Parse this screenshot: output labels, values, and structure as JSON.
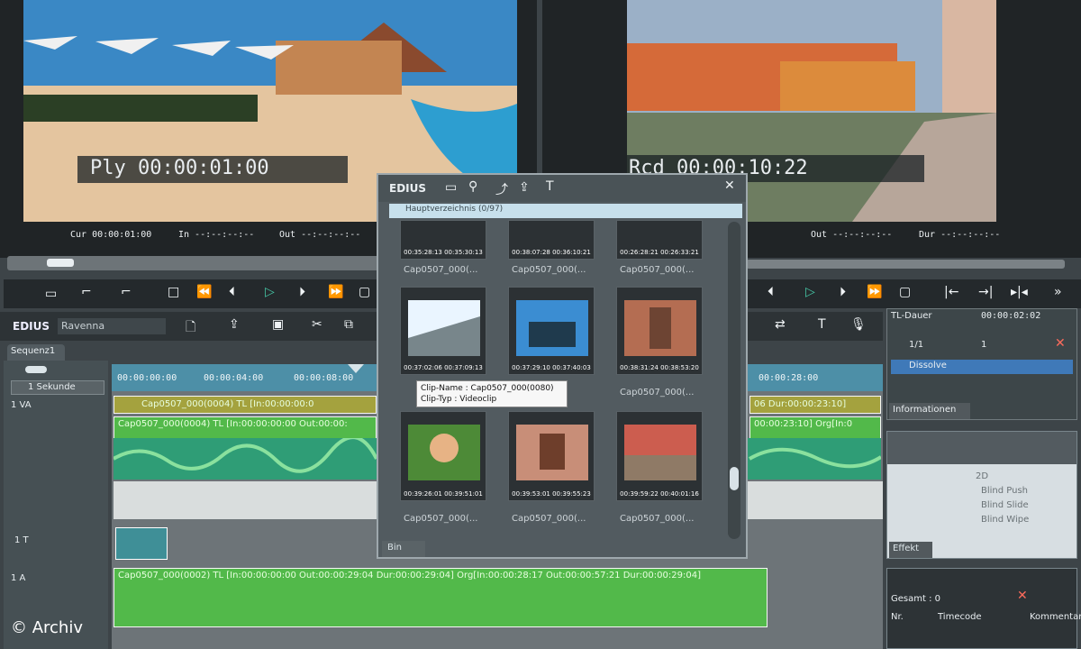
{
  "player": {
    "label": "Ply 00:00:01:00",
    "cur": "Cur 00:00:01:00",
    "in": "In --:--:--:--",
    "out": "Out --:--:--:--"
  },
  "recorder": {
    "label": "Rcd 00:00:10:22",
    "out": "Out --:--:--:--",
    "dur": "Dur --:--:--:--"
  },
  "main_toolbar": {
    "app": "EDIUS",
    "project": "Ravenna",
    "sequence_tab": "Sequenz1",
    "zoom": "1 Sekunde",
    "ruler": [
      "00:00:00:00",
      "00:00:04:00",
      "00:00:08:00",
      "00:00:28:00"
    ]
  },
  "tracks": {
    "va": {
      "label": "1 VA",
      "clip_top": "Cap0507_000(0004)  TL [In:00:00:00:0",
      "clip_top_right": "06 Dur:00:00:23:10]",
      "clip_main": "Cap0507_000(0004)  TL [In:00:00:00:00 Out:00:00:",
      "clip_main_right": "00:00:23:10]  Org[In:0"
    },
    "t": {
      "label": "1 T"
    },
    "a": {
      "label": "1 A",
      "clip": "Cap0507_000(0002)  TL [In:00:00:00:00 Out:00:00:29:04 Dur:00:00:29:04]  Org[In:00:00:28:17 Out:00:00:57:21 Dur:00:00:29:04]"
    }
  },
  "bin": {
    "app": "EDIUS",
    "folder": "Hauptverzeichnis (0/97)",
    "tab": "Bin",
    "rows": [
      {
        "tcs": [
          "00:35:28:13\n00:35:30:13",
          "00:38:07:28\n00:36:10:21",
          "00:26:28:21\n00:26:33:21"
        ],
        "caps": [
          "Cap0507_000(...",
          "Cap0507_000(...",
          "Cap0507_000(..."
        ]
      },
      {
        "tcs": [
          "00:37:02:06\n00:37:09:13",
          "00:37:29:10\n00:37:40:03",
          "00:38:31:24\n00:38:53:20"
        ],
        "caps": [
          "",
          "",
          "Cap0507_000(..."
        ]
      },
      {
        "tcs": [
          "00:39:26:01\n00:39:51:01",
          "00:39:53:01\n00:39:55:23",
          "00:39:59:22\n00:40:01:16"
        ],
        "caps": [
          "Cap0507_000(...",
          "Cap0507_000(...",
          "Cap0507_000(..."
        ]
      }
    ],
    "tooltip": {
      "name": "Clip-Name : Cap0507_000(0080)",
      "type": "Clip-Typ : Videoclip"
    }
  },
  "info_panel": {
    "tl": "TL-Dauer",
    "tl_value": "00:00:02:02",
    "count": "1/1",
    "count2": "1",
    "item": "Dissolve",
    "tab": "Informationen"
  },
  "effects_panel": {
    "folder": "2D",
    "items": [
      "Blind Push",
      "Blind Slide",
      "Blind Wipe"
    ],
    "tab": "Effekt"
  },
  "markers_panel": {
    "total": "Gesamt : 0",
    "cols": [
      "Nr.",
      "Timecode",
      "Kommentar"
    ]
  },
  "watermark": "© Archiv"
}
